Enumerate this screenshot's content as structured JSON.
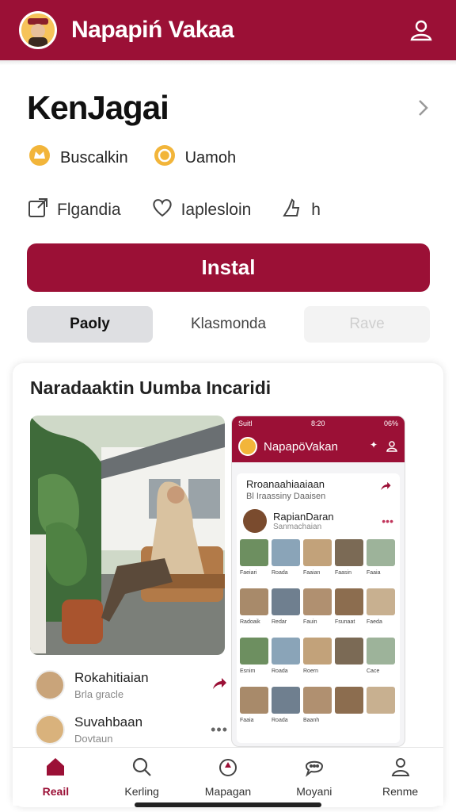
{
  "header": {
    "title": "Napapiń Vakaa"
  },
  "app": {
    "name": "KenJagai"
  },
  "meta": [
    {
      "icon": "crown-icon",
      "label": "Buscalkin",
      "color": "#f2b53a"
    },
    {
      "icon": "coin-icon",
      "label": "Uamoh",
      "color": "#f2b53a"
    }
  ],
  "actions": [
    {
      "icon": "share-icon",
      "label": "Flgandia"
    },
    {
      "icon": "heart-icon",
      "label": "Iaplesloin"
    },
    {
      "icon": "thumb-icon",
      "label": "h"
    }
  ],
  "install_label": "Instal",
  "tabs": [
    {
      "label": "Paoly",
      "state": "active"
    },
    {
      "label": "Klasmonda",
      "state": "plain"
    },
    {
      "label": "Rave",
      "state": "disabled"
    }
  ],
  "card": {
    "title": "Naradaaktin Uumba Incaridi",
    "comments": [
      {
        "name": "Rokahitiaian",
        "sub": "Brla gracle"
      },
      {
        "name": "Suvahbaan",
        "sub": "Dovtaun"
      }
    ]
  },
  "phone": {
    "status_left": "Suitl",
    "status_time": "8:20",
    "status_right": "06%",
    "title": "NapapöVakan",
    "row1_title": "Rroanaahiaaiaan",
    "row1_sub": "Bl Iraassiny Daaisen",
    "row2_title": "RapianDaran",
    "row2_sub": "Sanmachaian",
    "grid_labels": [
      "Faeiari",
      "Roada",
      "Faaian",
      "Faasin",
      "Faaia",
      "Radoaik",
      "Redar",
      "Fauin",
      "Fsunaat",
      "Faeda",
      "Esnim",
      "Roada",
      "Roern",
      "",
      "Cace",
      "Faaia",
      "Roada",
      "Baanh",
      "",
      ""
    ]
  },
  "bottom_nav": [
    {
      "icon": "home-icon",
      "label": "Reail",
      "active": true
    },
    {
      "icon": "search-icon",
      "label": "Kerling",
      "active": false
    },
    {
      "icon": "rocket-icon",
      "label": "Mapagan",
      "active": false
    },
    {
      "icon": "chat-icon",
      "label": "Moyani",
      "active": false
    },
    {
      "icon": "profile-icon",
      "label": "Renme",
      "active": false
    }
  ]
}
